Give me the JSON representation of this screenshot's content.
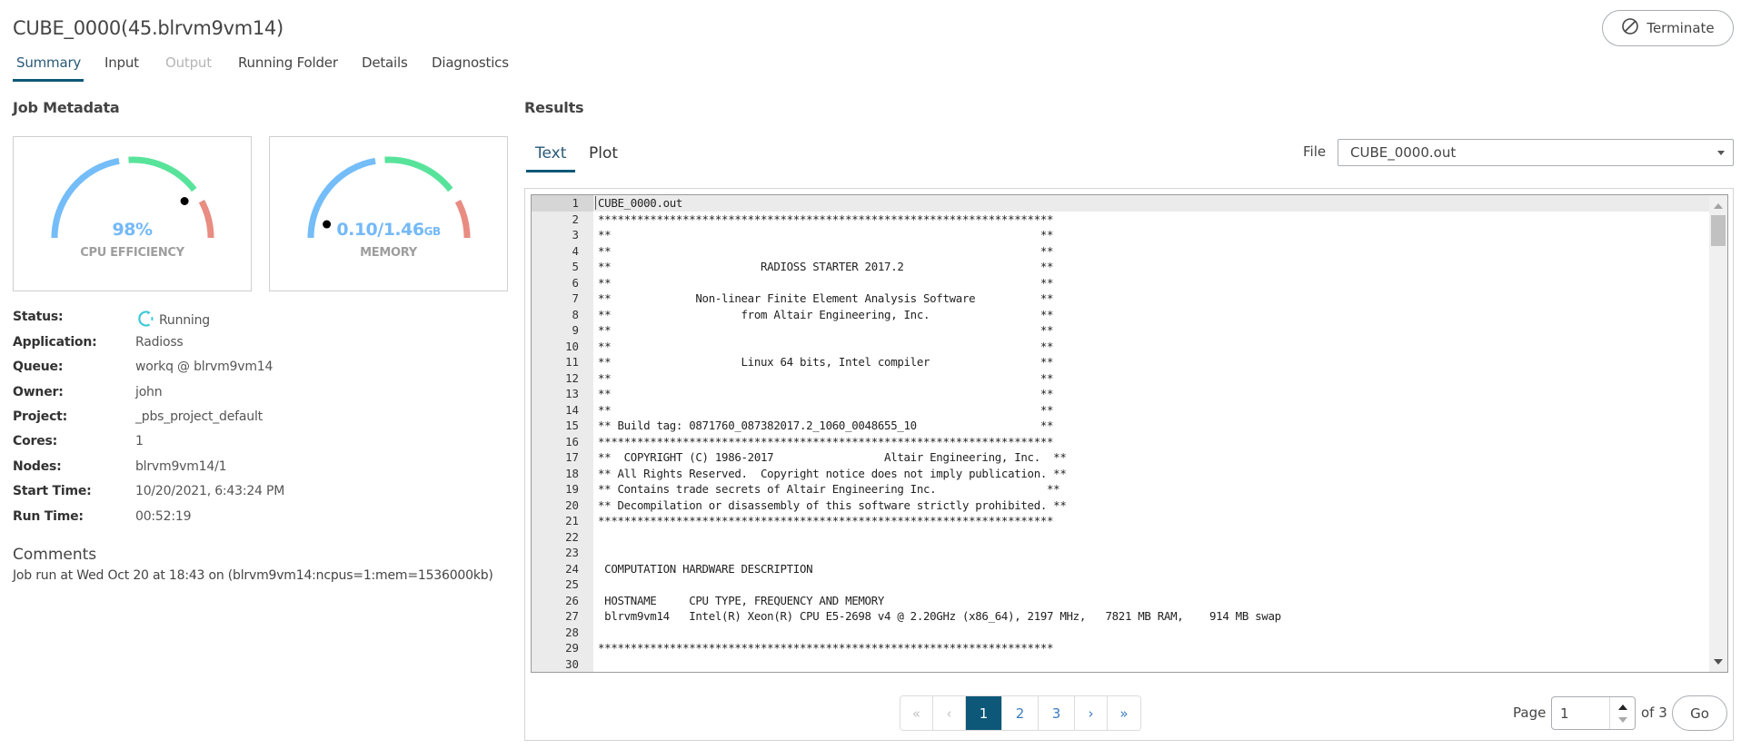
{
  "header": {
    "title": "CUBE_0000(45.blrvm9vm14)",
    "terminate_label": "Terminate",
    "terminate_icon": "prohibited-icon"
  },
  "tabs": [
    {
      "label": "Summary",
      "state": "active"
    },
    {
      "label": "Input",
      "state": "normal"
    },
    {
      "label": "Output",
      "state": "disabled"
    },
    {
      "label": "Running Folder",
      "state": "normal"
    },
    {
      "label": "Details",
      "state": "normal"
    },
    {
      "label": "Diagnostics",
      "state": "normal"
    }
  ],
  "metadata": {
    "heading": "Job Metadata",
    "gauges": {
      "cpu": {
        "value_text": "98%",
        "label": "CPU EFFICIENCY",
        "fraction": 0.98
      },
      "memory": {
        "value_text": "0.10/1.46",
        "unit": "GB",
        "label": "MEMORY",
        "used": 0.1,
        "total": 1.46
      }
    },
    "gauge_colors": {
      "low": "#74bdf8",
      "mid": "#58e39b",
      "high": "#e98c82",
      "value_text": "#74b9f7"
    },
    "rows": [
      {
        "label": "Status:",
        "value": "Running",
        "icon": "spinner-icon"
      },
      {
        "label": "Application:",
        "value": "Radioss"
      },
      {
        "label": "Queue:",
        "value": "workq @ blrvm9vm14"
      },
      {
        "label": "Owner:",
        "value": "john"
      },
      {
        "label": "Project:",
        "value": "_pbs_project_default"
      },
      {
        "label": "Cores:",
        "value": "1"
      },
      {
        "label": "Nodes:",
        "value": "blrvm9vm14/1"
      },
      {
        "label": "Start Time:",
        "value": "10/20/2021, 6:43:24 PM"
      },
      {
        "label": "Run Time:",
        "value": "00:52:19"
      }
    ],
    "comments_heading": "Comments",
    "comments_text": "Job run at Wed Oct 20 at 18:43 on (blrvm9vm14:ncpus=1:mem=1536000kb)"
  },
  "results": {
    "heading": "Results",
    "subtabs": [
      {
        "label": "Text",
        "state": "active"
      },
      {
        "label": "Plot",
        "state": "normal"
      }
    ],
    "file_label": "File",
    "file_selected": "CUBE_0000.out",
    "lines": [
      {
        "n": "1",
        "text": "CUBE_0000.out"
      },
      {
        "n": "2",
        "text": "**********************************************************************"
      },
      {
        "n": "3",
        "text": "**                                                                  **"
      },
      {
        "n": "4",
        "text": "**                                                                  **"
      },
      {
        "n": "5",
        "text": "**                       RADIOSS STARTER 2017.2                     **"
      },
      {
        "n": "6",
        "text": "**                                                                  **"
      },
      {
        "n": "7",
        "text": "**             Non-linear Finite Element Analysis Software          **"
      },
      {
        "n": "8",
        "text": "**                    from Altair Engineering, Inc.                 **"
      },
      {
        "n": "9",
        "text": "**                                                                  **"
      },
      {
        "n": "10",
        "text": "**                                                                  **"
      },
      {
        "n": "11",
        "text": "**                    Linux 64 bits, Intel compiler                 **"
      },
      {
        "n": "12",
        "text": "**                                                                  **"
      },
      {
        "n": "13",
        "text": "**                                                                  **"
      },
      {
        "n": "14",
        "text": "**                                                                  **"
      },
      {
        "n": "15",
        "text": "** Build tag: 0871760_087382017.2_1060_0048655_10                   **"
      },
      {
        "n": "16",
        "text": "**********************************************************************"
      },
      {
        "n": "17",
        "text": "**  COPYRIGHT (C) 1986-2017                 Altair Engineering, Inc.  **"
      },
      {
        "n": "18",
        "text": "** All Rights Reserved.  Copyright notice does not imply publication. **"
      },
      {
        "n": "19",
        "text": "** Contains trade secrets of Altair Engineering Inc.                 **"
      },
      {
        "n": "20",
        "text": "** Decompilation or disassembly of this software strictly prohibited. **"
      },
      {
        "n": "21",
        "text": "**********************************************************************"
      },
      {
        "n": "22",
        "text": ""
      },
      {
        "n": "23",
        "text": ""
      },
      {
        "n": "24",
        "text": " COMPUTATION HARDWARE DESCRIPTION"
      },
      {
        "n": "25",
        "text": ""
      },
      {
        "n": "26",
        "text": " HOSTNAME     CPU TYPE, FREQUENCY AND MEMORY"
      },
      {
        "n": "27",
        "text": " blrvm9vm14   Intel(R) Xeon(R) CPU E5-2698 v4 @ 2.20GHz (x86_64), 2197 MHz,   7821 MB RAM,    914 MB swap"
      },
      {
        "n": "28",
        "text": ""
      },
      {
        "n": "29",
        "text": "**********************************************************************"
      },
      {
        "n": "30",
        "text": ""
      }
    ],
    "pagination": {
      "first": "«",
      "prev": "‹",
      "pages": [
        "1",
        "2",
        "3"
      ],
      "current": "1",
      "next": "›",
      "last": "»",
      "page_label": "Page",
      "page_input_value": "1",
      "of_label": "of 3",
      "go_label": "Go"
    }
  },
  "colors": {
    "accent": "#0d5878",
    "link": "#3b7bbf",
    "spinner": "#3cc9d6"
  }
}
